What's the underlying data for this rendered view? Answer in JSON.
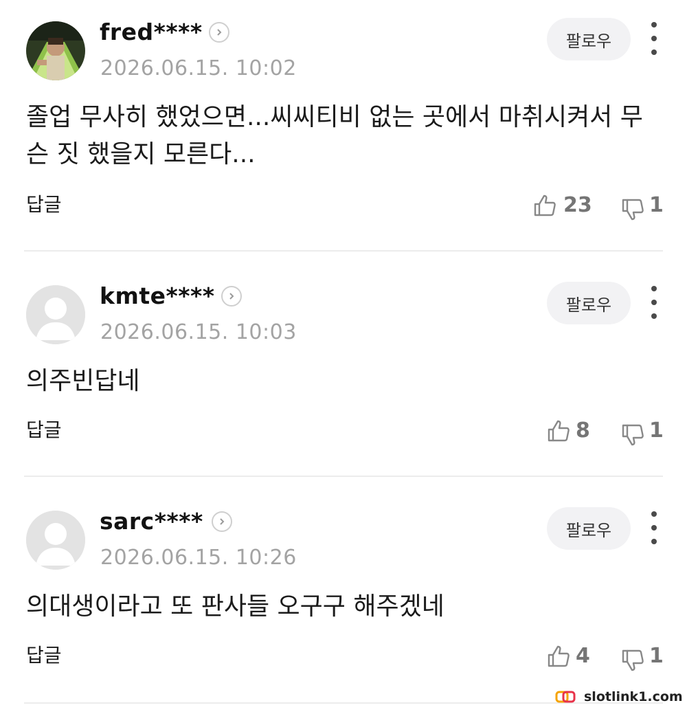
{
  "follow_label": "팔로우",
  "reply_label": "답글",
  "comments": [
    {
      "username": "fred****",
      "timestamp": "2026.06.15. 10:02",
      "body": "졸업 무사히 했었으면...씨씨티비 없는 곳에서 마취시켜서 무슨 짓 했을지 모른다...",
      "likes": "23",
      "dislikes": "1",
      "avatar": "photo-avatar"
    },
    {
      "username": "kmte****",
      "timestamp": "2026.06.15. 10:03",
      "body": "의주빈답네",
      "likes": "8",
      "dislikes": "1",
      "avatar": "default-avatar"
    },
    {
      "username": "sarc****",
      "timestamp": "2026.06.15. 10:26",
      "body": "의대생이라고 또 판사들 오구구 해주겠네",
      "likes": "4",
      "dislikes": "1",
      "avatar": "default-avatar"
    }
  ],
  "watermark": {
    "text": "slotlink1.com",
    "colors": [
      "#f5a300",
      "#e8334a"
    ]
  },
  "colors": {
    "timestamp": "#a3a3a3",
    "count": "#757575",
    "follow_bg": "#f2f2f4",
    "divider": "#ececec"
  }
}
